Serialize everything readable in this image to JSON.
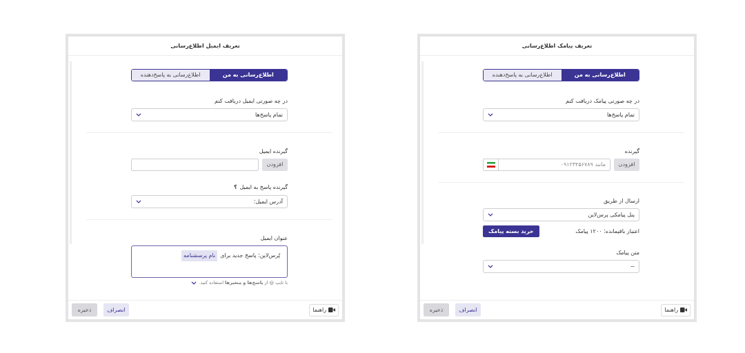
{
  "dialogs": [
    {
      "title": "تعریف پیامک اطلاع‌رسانی",
      "tabs": [
        {
          "label": "اطلاع‌رسانی به من",
          "selected": true
        },
        {
          "label": "اطلاع‌رسانی به پاسخ‌دهنده",
          "selected": false
        }
      ],
      "blocks": [
        {
          "kind": "select",
          "label": "در چه صورتی پیامک دریافت کنم",
          "value": "تمام پاسخ‌ها"
        },
        {
          "kind": "divider"
        },
        {
          "kind": "phone_input",
          "label": "گیرنده",
          "button": "افزودن",
          "placeholder": "مانند ۰۹۱۲۳۴۵۶۷۸۹"
        },
        {
          "kind": "divider"
        },
        {
          "kind": "select",
          "label": "ارسال از طریق",
          "value": "پنل پیامکی پرس‌لاین"
        },
        {
          "kind": "credit",
          "text": "اعتبار باقیمانده: ۱۲۰۰ پیامک",
          "button": "خرید بسته پیامک"
        },
        {
          "kind": "select",
          "label": "متن پیامک",
          "value": "--"
        }
      ],
      "footer": {
        "guide": "راهنما",
        "cancel": "انصراف",
        "save": "ذخیره"
      }
    },
    {
      "title": "تعریف ایمیل اطلاع‌رسانی",
      "tabs": [
        {
          "label": "اطلاع‌رسانی به من",
          "selected": true
        },
        {
          "label": "اطلاع‌رسانی به پاسخ‌دهنده",
          "selected": false
        }
      ],
      "blocks": [
        {
          "kind": "select",
          "label": "در چه صورتی ایمیل دریافت کنم",
          "value": "تمام پاسخ‌ها"
        },
        {
          "kind": "divider"
        },
        {
          "kind": "add_input",
          "label": "گیرنده ایمیل",
          "button": "افزودن"
        },
        {
          "kind": "select",
          "label": "گیرنده پاسخ به ایمیل",
          "help": "؟",
          "value": "آدرس ایمیل:"
        },
        {
          "kind": "divider"
        },
        {
          "kind": "rich_text",
          "label": "عنوان ایمیل",
          "text": "پُرس‌لاین: پاسخ جدید برای",
          "chip": "نام پرسشنامه",
          "hint": "با تایپ @ از **پاسخ‌ها و متغیرها** استفاده کنید."
        }
      ],
      "footer": {
        "guide": "راهنما",
        "cancel": "انصراف",
        "save": "ذخیره"
      }
    }
  ]
}
